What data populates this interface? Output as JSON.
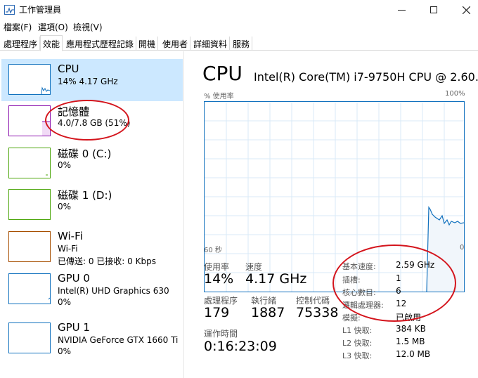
{
  "window": {
    "title": "工作管理員",
    "minimize": "–",
    "maximize": "☐",
    "close": "✕"
  },
  "menu": [
    "檔案(F)",
    "選項(O)",
    "檢視(V)"
  ],
  "tabs": [
    "處理程序",
    "效能",
    "應用程式歷程記錄",
    "開機",
    "使用者",
    "詳細資料",
    "服務"
  ],
  "active_tab": "效能",
  "sidebar": {
    "items": [
      {
        "name": "CPU",
        "line1": "14% 4.17 GHz",
        "line2": "",
        "selected": true,
        "color": "#1171be"
      },
      {
        "name": "記憶體",
        "line1": "4.0/7.8 GB (51%)",
        "line2": "",
        "selected": false,
        "color": "#8b12ae"
      },
      {
        "name": "磁碟 0 (C:)",
        "line1": "0%",
        "line2": "",
        "selected": false,
        "color": "#4da60c"
      },
      {
        "name": "磁碟 1 (D:)",
        "line1": "0%",
        "line2": "",
        "selected": false,
        "color": "#4da60c"
      },
      {
        "name": "Wi-Fi",
        "line1": "Wi-Fi",
        "line2": "已傳送: 0 已接收: 0 Kbps",
        "selected": false,
        "color": "#a74f01"
      },
      {
        "name": "GPU 0",
        "line1": "Intel(R) UHD Graphics 630",
        "line2": "0%",
        "selected": false,
        "color": "#1171be"
      },
      {
        "name": "GPU 1",
        "line1": "NVIDIA GeForce GTX 1660 Ti",
        "line2": "0%",
        "selected": false,
        "color": "#1171be"
      }
    ]
  },
  "main": {
    "title": "CPU",
    "model": "Intel(R) Core(TM) i7-9750H CPU @ 2.60...",
    "graph": {
      "y_label": "% 使用率",
      "y_max_label": "100%",
      "x_left_label": "60 秒",
      "x_right_label": "0"
    },
    "stats": {
      "usage_label": "使用率",
      "usage_value": "14%",
      "speed_label": "速度",
      "speed_value": "4.17 GHz",
      "processes_label": "處理程序",
      "processes_value": "179",
      "threads_label": "執行緒",
      "threads_value": "1887",
      "handles_label": "控制代碼",
      "handles_value": "75338",
      "uptime_label": "運作時間",
      "uptime_value": "0:16:23:09"
    },
    "specs": [
      {
        "label": "基本速度:",
        "value": "2.59 GHz"
      },
      {
        "label": "插槽:",
        "value": "1"
      },
      {
        "label": "核心數目:",
        "value": "6"
      },
      {
        "label": "邏輯處理器:",
        "value": "12"
      },
      {
        "label": "模擬:",
        "value": "已啟用"
      },
      {
        "label": "L1 快取:",
        "value": "384 KB"
      },
      {
        "label": "L2 快取:",
        "value": "1.5 MB"
      },
      {
        "label": "L3 快取:",
        "value": "12.0 MB"
      }
    ]
  },
  "colors": {
    "selected_bg": "#cce8ff",
    "cpu_accent": "#1171be",
    "memory_accent": "#8b12ae",
    "disk_accent": "#4da60c",
    "wifi_accent": "#a74f01",
    "annotation_circle": "#d4141c"
  }
}
